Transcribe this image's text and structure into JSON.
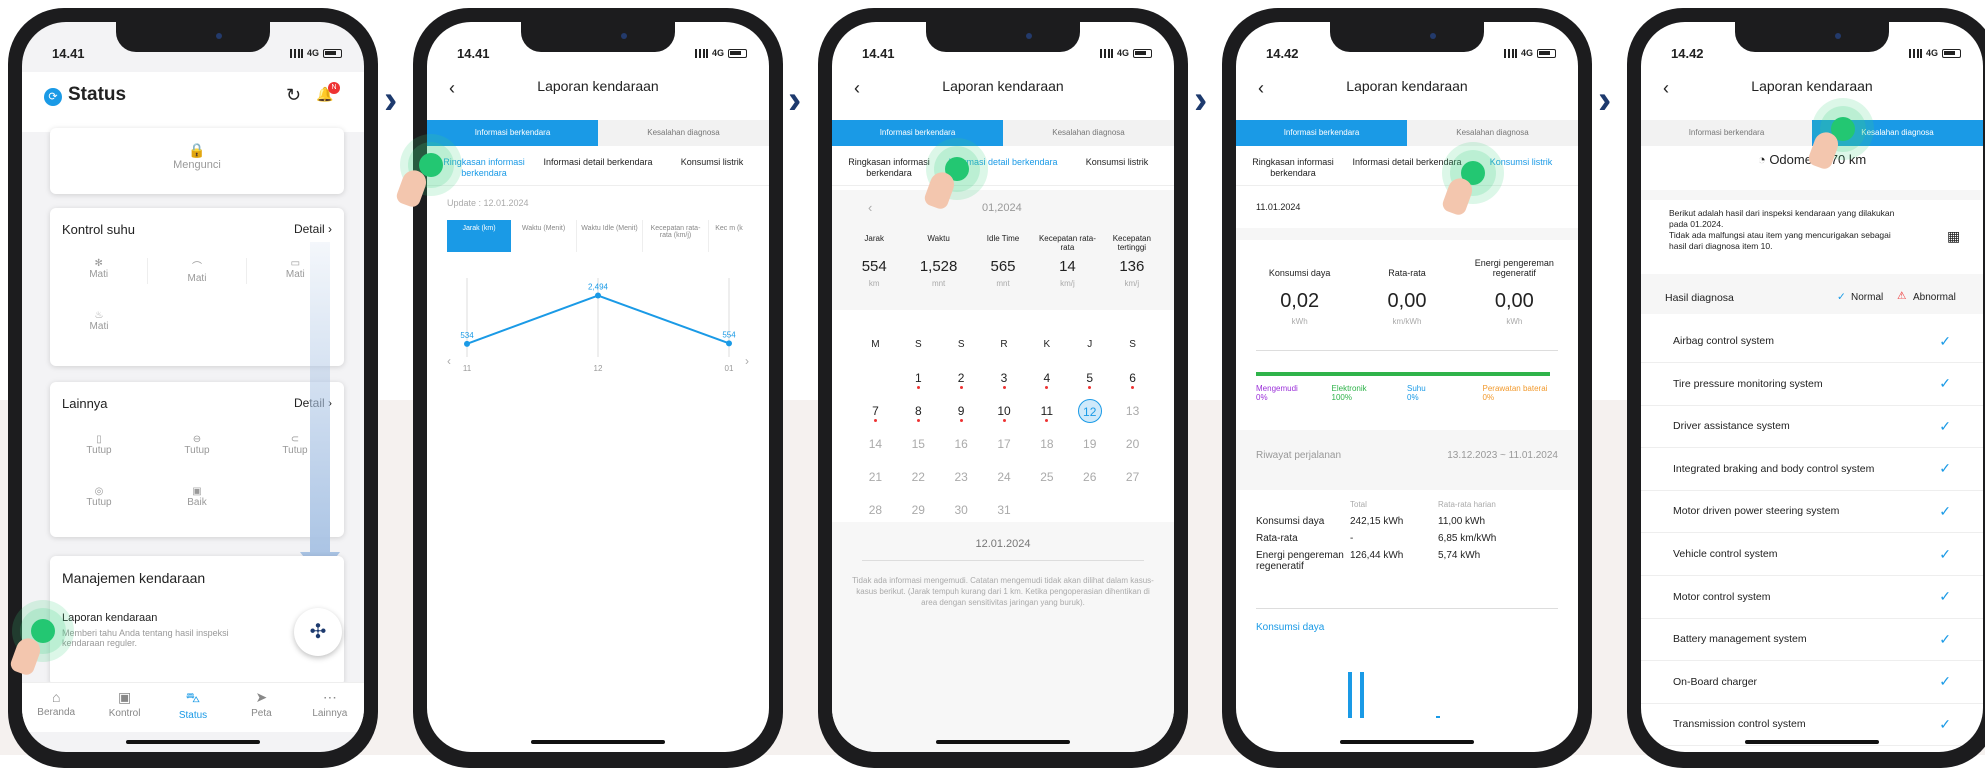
{
  "status_time": "14.41",
  "status_time_b": "14.42",
  "network": "4G",
  "screen1": {
    "title": "Status",
    "badge": "N",
    "lock_label": "Mengunci",
    "temp_title": "Kontrol suhu",
    "detail": "Detail",
    "temp_items": [
      "Mati",
      "Mati",
      "Mati",
      "Mati"
    ],
    "other_title": "Lainnya",
    "other_items": [
      "Tutup",
      "Tutup",
      "Tutup",
      "Tutup",
      "Baik"
    ],
    "mgmt_title": "Manajemen kendaraan",
    "report_title": "Laporan kendaraan",
    "report_desc": "Memberi tahu Anda tentang hasil inspeksi kendaraan reguler.",
    "nav": [
      "Beranda",
      "Kontrol",
      "Status",
      "Peta",
      "Lainnya"
    ]
  },
  "report_title": "Laporan kendaraan",
  "tabs": [
    "Informasi berkendara",
    "Kesalahan diagnosa"
  ],
  "subtabs": [
    "Ringkasan informasi berkendara",
    "Informasi detail berkendara",
    "Konsumsi listrik"
  ],
  "screen2": {
    "update": "Update : 12.01.2024",
    "metrics": [
      "Jarak (km)",
      "Waktu (Menit)",
      "Waktu Idle (Menit)",
      "Kecepatan rata-rata (km/j)",
      "Kec m (k"
    ],
    "chart_data": {
      "type": "line",
      "categories": [
        "11",
        "12",
        "01"
      ],
      "values": [
        534,
        2494,
        554
      ],
      "ylim": [
        0,
        2800
      ],
      "data_labels": [
        "534",
        "2,494",
        "554"
      ]
    }
  },
  "screen3": {
    "month": "01,2024",
    "stats": [
      {
        "label": "Jarak",
        "value": "554",
        "unit": "km"
      },
      {
        "label": "Waktu",
        "value": "1,528",
        "unit": "mnt"
      },
      {
        "label": "Idle Time",
        "value": "565",
        "unit": "mnt"
      },
      {
        "label": "Kecepatan rata-rata",
        "value": "14",
        "unit": "km/j"
      },
      {
        "label": "Kecepatan tertinggi",
        "value": "136",
        "unit": "km/j"
      }
    ],
    "weekdays": [
      "M",
      "S",
      "S",
      "R",
      "K",
      "J",
      "S"
    ],
    "weeks": [
      [
        "",
        "1",
        "2",
        "3",
        "4",
        "5",
        "6"
      ],
      [
        "7",
        "8",
        "9",
        "10",
        "11",
        "12",
        "13"
      ],
      [
        "14",
        "15",
        "16",
        "17",
        "18",
        "19",
        "20"
      ],
      [
        "21",
        "22",
        "23",
        "24",
        "25",
        "26",
        "27"
      ],
      [
        "28",
        "29",
        "30",
        "31",
        "",
        "",
        ""
      ]
    ],
    "date": "12.01.2024",
    "note": "Tidak ada informasi mengemudi. Catatan mengemudi tidak akan dilihat dalam kasus-kasus berikut. (Jarak tempuh kurang dari 1 km. Ketika pengoperasian dihentikan di area dengan sensitivitas jaringan yang buruk)."
  },
  "screen4": {
    "date": "11.01.2024",
    "cols": [
      {
        "label": "Konsumsi daya",
        "value": "0,02",
        "unit": "kWh"
      },
      {
        "label": "Rata-rata",
        "value": "0,00",
        "unit": "km/kWh"
      },
      {
        "label": "Energi pengereman regeneratif",
        "value": "0,00",
        "unit": "kWh"
      }
    ],
    "legend": [
      {
        "label": "Mengemudi",
        "pct": "0%",
        "color": "#9b30d9"
      },
      {
        "label": "Elektronik",
        "pct": "100%",
        "color": "#2fb34a"
      },
      {
        "label": "Suhu",
        "pct": "0%",
        "color": "#1a9ae6"
      },
      {
        "label": "Perawatan baterai",
        "pct": "0%",
        "color": "#f29a2e"
      }
    ],
    "history_label": "Riwayat perjalanan",
    "history_range": "13.12.2023 ~ 11.01.2024",
    "table_head": [
      "Total",
      "Rata-rata harian"
    ],
    "table_rows": [
      [
        "Konsumsi daya",
        "242,15 kWh",
        "11,00 kWh"
      ],
      [
        "Rata-rata",
        "-",
        "6,85 km/kWh"
      ],
      [
        "Energi pengereman regeneratif",
        "126,44 kWh",
        "5,74 kWh"
      ]
    ],
    "link": "Konsumsi daya"
  },
  "screen5": {
    "odometer": "Odometer",
    "odo_value": "70 km",
    "message": "Berikut adalah hasil dari inspeksi kendaraan yang dilakukan pada 01.2024.\nTidak ada malfungsi atau item yang mencurigakan sebagai hasil dari diagnosa item 10.",
    "result": "Hasil diagnosa",
    "normal": "Normal",
    "abnormal": "Abnormal",
    "items": [
      "Airbag control system",
      "Tire pressure monitoring system",
      "Driver assistance system",
      "Integrated braking and body control system",
      "Motor driven power steering system",
      "Vehicle control system",
      "Motor control system",
      "Battery management system",
      "On-Board charger",
      "Transmission control system"
    ]
  }
}
